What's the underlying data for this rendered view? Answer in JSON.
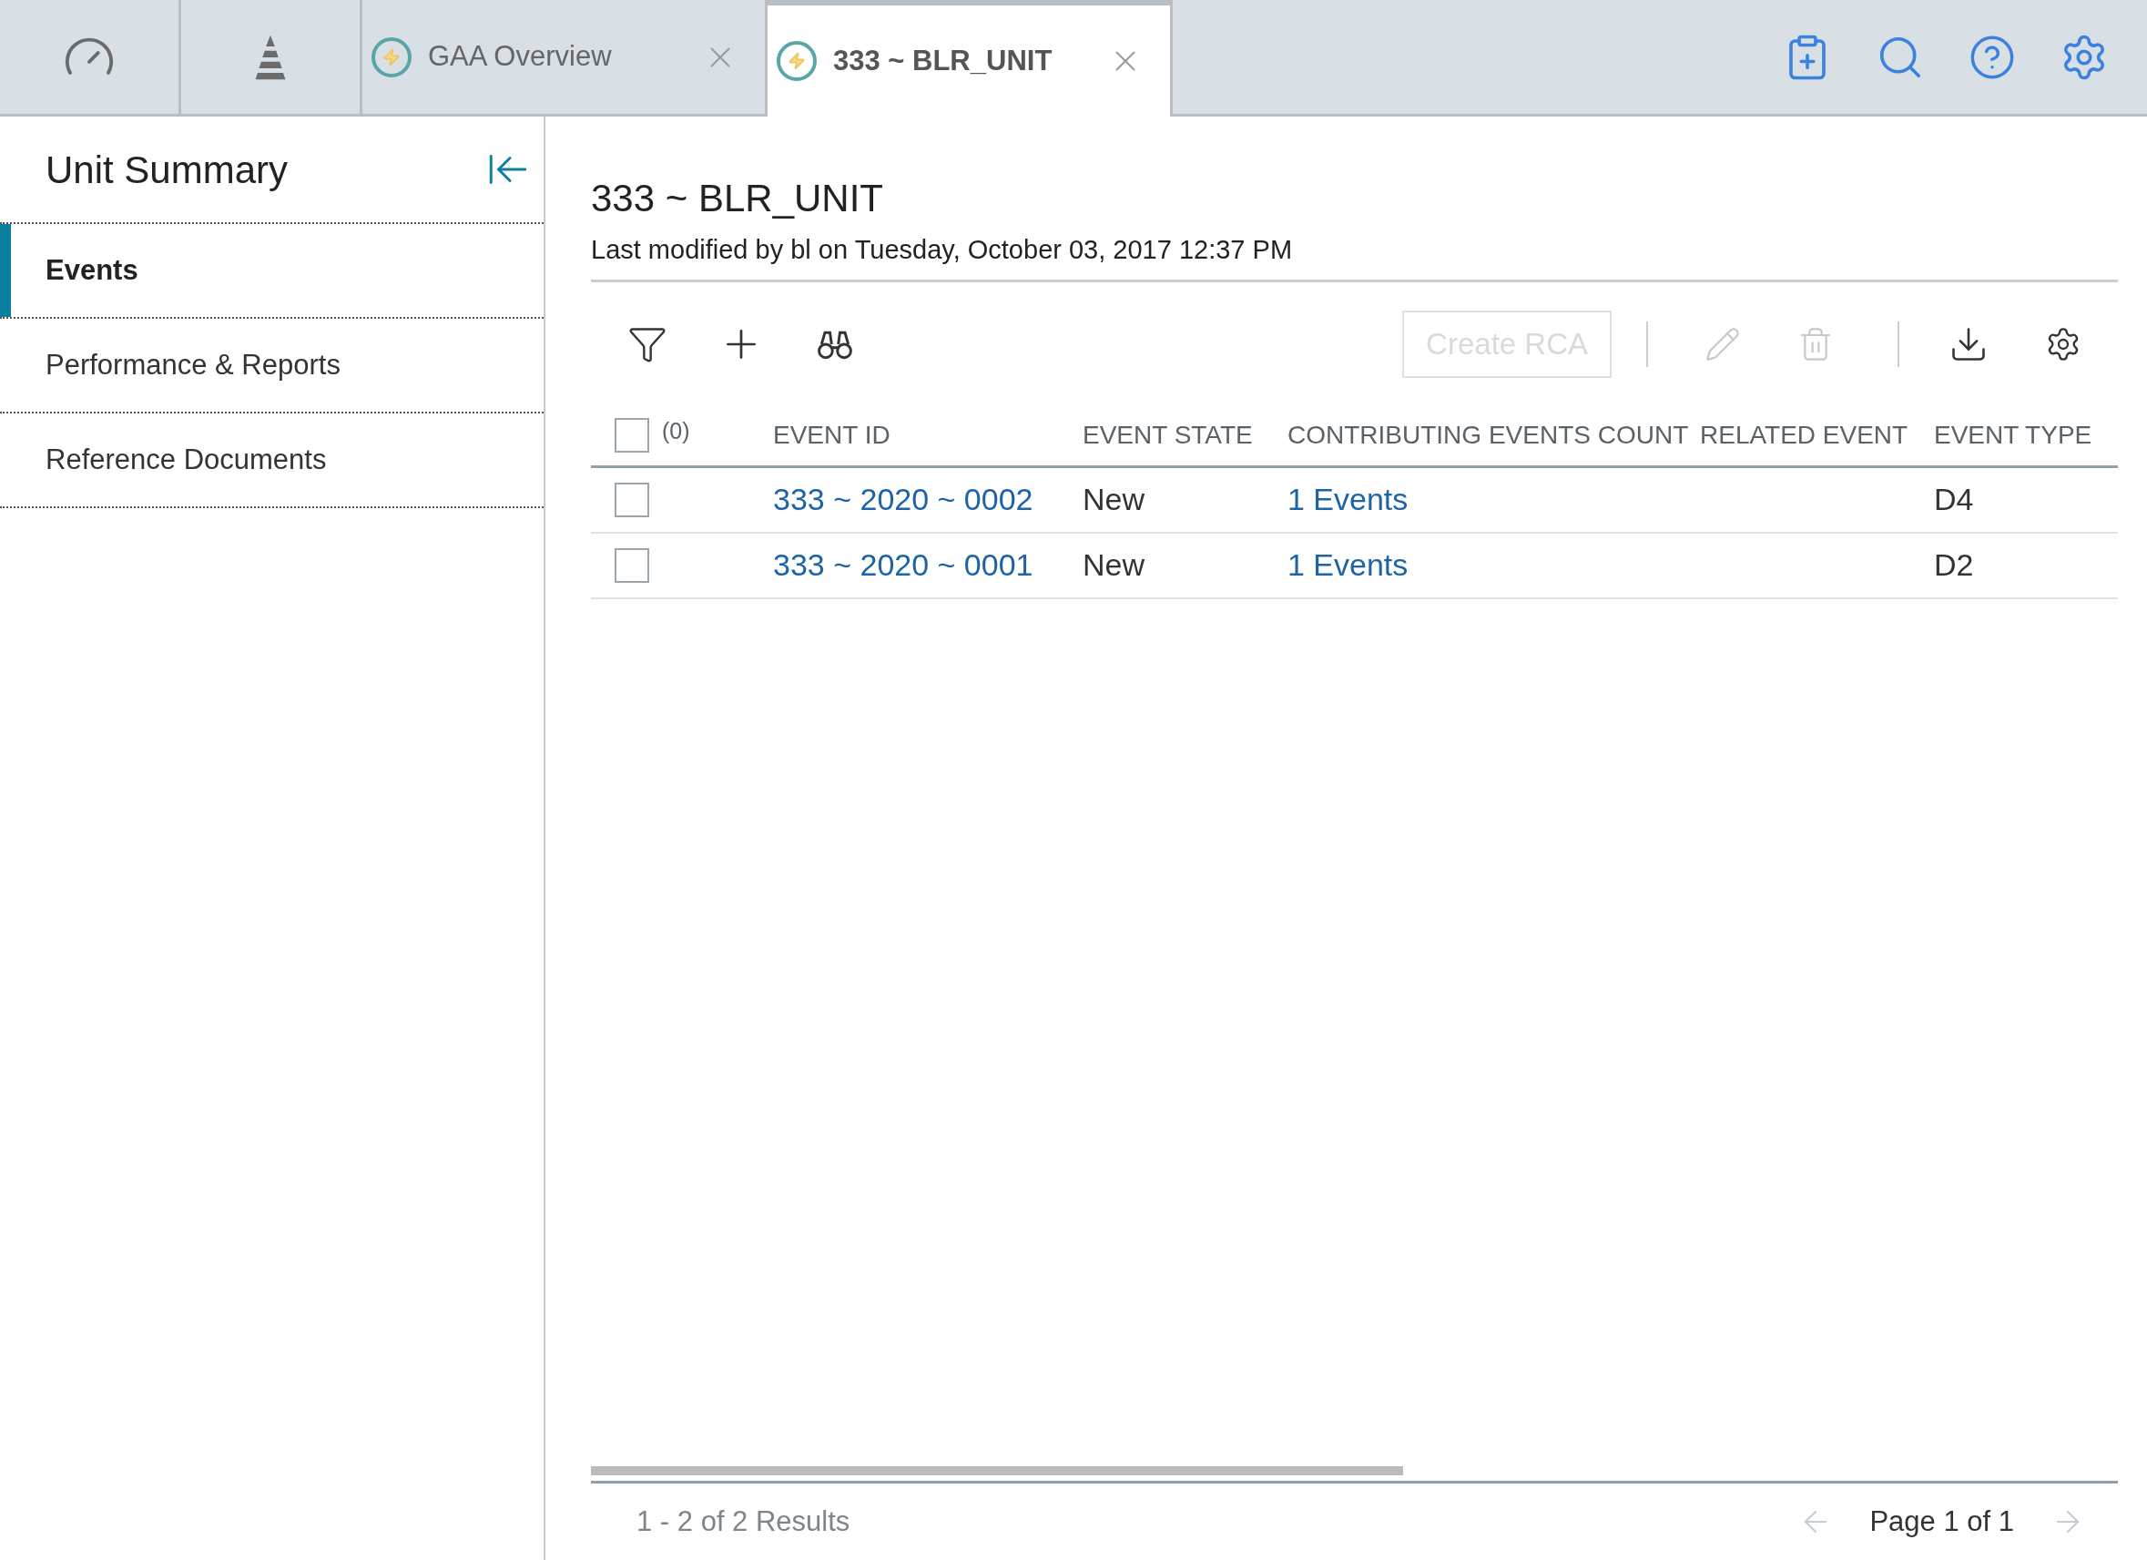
{
  "tabs": [
    {
      "kind": "gauge",
      "selected": false
    },
    {
      "kind": "pyramid",
      "selected": false
    },
    {
      "kind": "doc",
      "label": "GAA Overview",
      "selected": false
    },
    {
      "kind": "doc",
      "label": "333 ~ BLR_UNIT",
      "selected": true
    }
  ],
  "sidebar": {
    "title": "Unit Summary",
    "items": [
      {
        "label": "Events",
        "selected": true
      },
      {
        "label": "Performance & Reports",
        "selected": false
      },
      {
        "label": "Reference Documents",
        "selected": false
      }
    ]
  },
  "page": {
    "title": "333 ~ BLR_UNIT",
    "subtitle": "Last modified by bl on Tuesday, October 03, 2017 12:37 PM"
  },
  "toolbar": {
    "create_button": {
      "label": "Create RCA",
      "disabled": true
    },
    "edit_disabled": true,
    "delete_disabled": true
  },
  "table": {
    "select_all": {
      "checked": false,
      "count": "(0)"
    },
    "columns": [
      "EVENT ID",
      "EVENT STATE",
      "CONTRIBUTING EVENTS COUNT",
      "RELATED EVENT",
      "EVENT TYPE"
    ],
    "rows": [
      {
        "checked": false,
        "event_id": "333 ~ 2020 ~ 0002",
        "event_state": "New",
        "contributing_events_count": "1 Events",
        "event_type": "D4"
      },
      {
        "checked": false,
        "event_id": "333 ~ 2020 ~ 0001",
        "event_state": "New",
        "contributing_events_count": "1 Events",
        "event_type": "D2"
      }
    ]
  },
  "footer": {
    "results": "1 - 2 of 2 Results",
    "page": "Page 1 of 1"
  }
}
